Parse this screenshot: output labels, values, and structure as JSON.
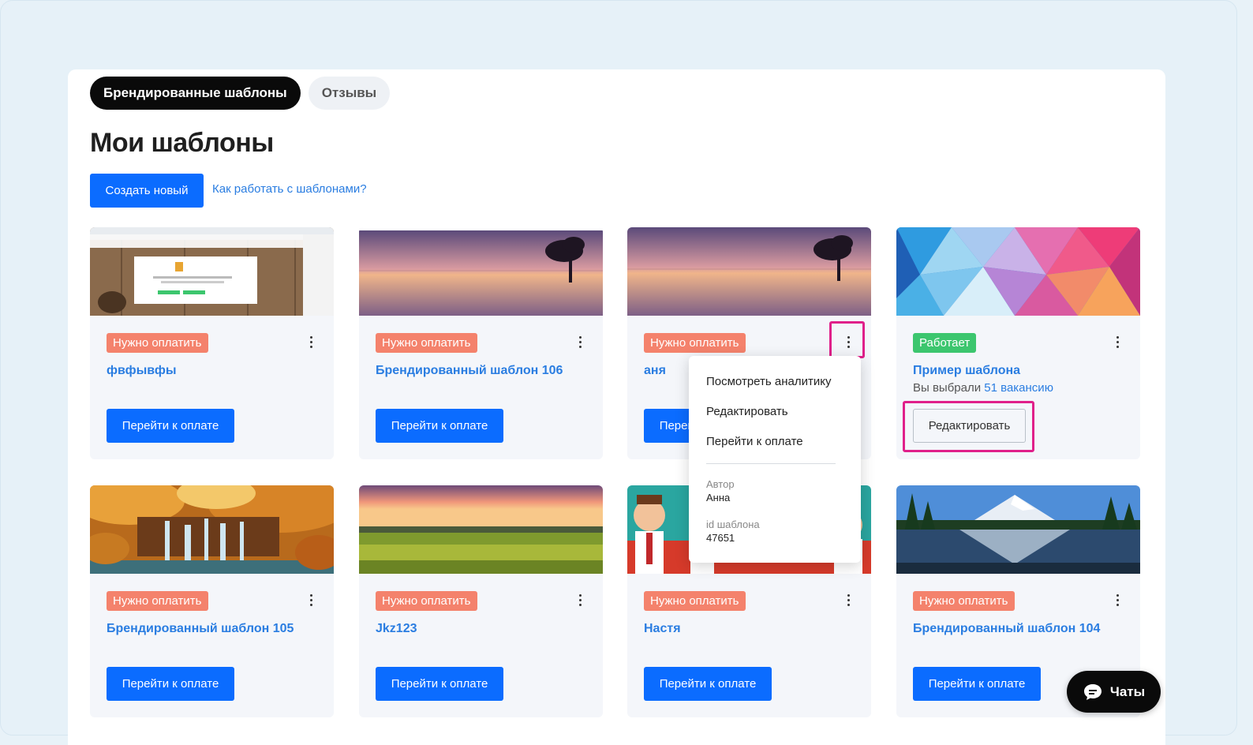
{
  "tabs": [
    {
      "label": "Брендированные шаблоны",
      "active": true
    },
    {
      "label": "Отзывы",
      "active": false
    }
  ],
  "page_title": "Мои шаблоны",
  "actions": {
    "create_label": "Создать новый",
    "help_link": "Как работать с шаблонами?"
  },
  "cards": [
    {
      "status": "Нужно оплатить",
      "title": "фвфывфы",
      "button": "Перейти к оплате",
      "thumb": "browser-screenshot-wood"
    },
    {
      "status": "Нужно оплатить",
      "title": "Брендированный шаблон 106",
      "button": "Перейти к оплате",
      "thumb": "sunset-lake-tree"
    },
    {
      "status": "Нужно оплатить",
      "title": "аня",
      "button": "Перейти к оплате",
      "thumb": "sunset-lake-tree"
    },
    {
      "status": "Работает",
      "title": "Пример шаблона",
      "subtitle_prefix": "Вы выбрали",
      "subtitle_link": "51 вакансию",
      "button": "Редактировать",
      "thumb": "colorful-polygons"
    },
    {
      "status": "Нужно оплатить",
      "title": "Брендированный шаблон 105",
      "button": "Перейти к оплате",
      "thumb": "autumn-waterfall"
    },
    {
      "status": "Нужно оплатить",
      "title": "Jkz123",
      "button": "Перейти к оплате",
      "thumb": "sunset-field"
    },
    {
      "status": "Нужно оплатить",
      "title": "Настя",
      "button": "Перейти к оплате",
      "thumb": "cartoon-people"
    },
    {
      "status": "Нужно оплатить",
      "title": "Брендированный шаблон 104",
      "button": "Перейти к оплате",
      "thumb": "mountain-lake"
    }
  ],
  "context_menu": {
    "items": [
      "Посмотреть аналитику",
      "Редактировать",
      "Перейти к оплате"
    ],
    "author_label": "Автор",
    "author_value": "Анна",
    "id_label": "id шаблона",
    "id_value": "47651"
  },
  "chat_button": {
    "label": "Чаты",
    "icon": "chat-bubble-icon"
  },
  "colors": {
    "primary": "#0b6cff",
    "link": "#2a7de1",
    "status_pay": "#f4826c",
    "status_ok": "#3cc66e",
    "highlight": "#e0208a"
  }
}
